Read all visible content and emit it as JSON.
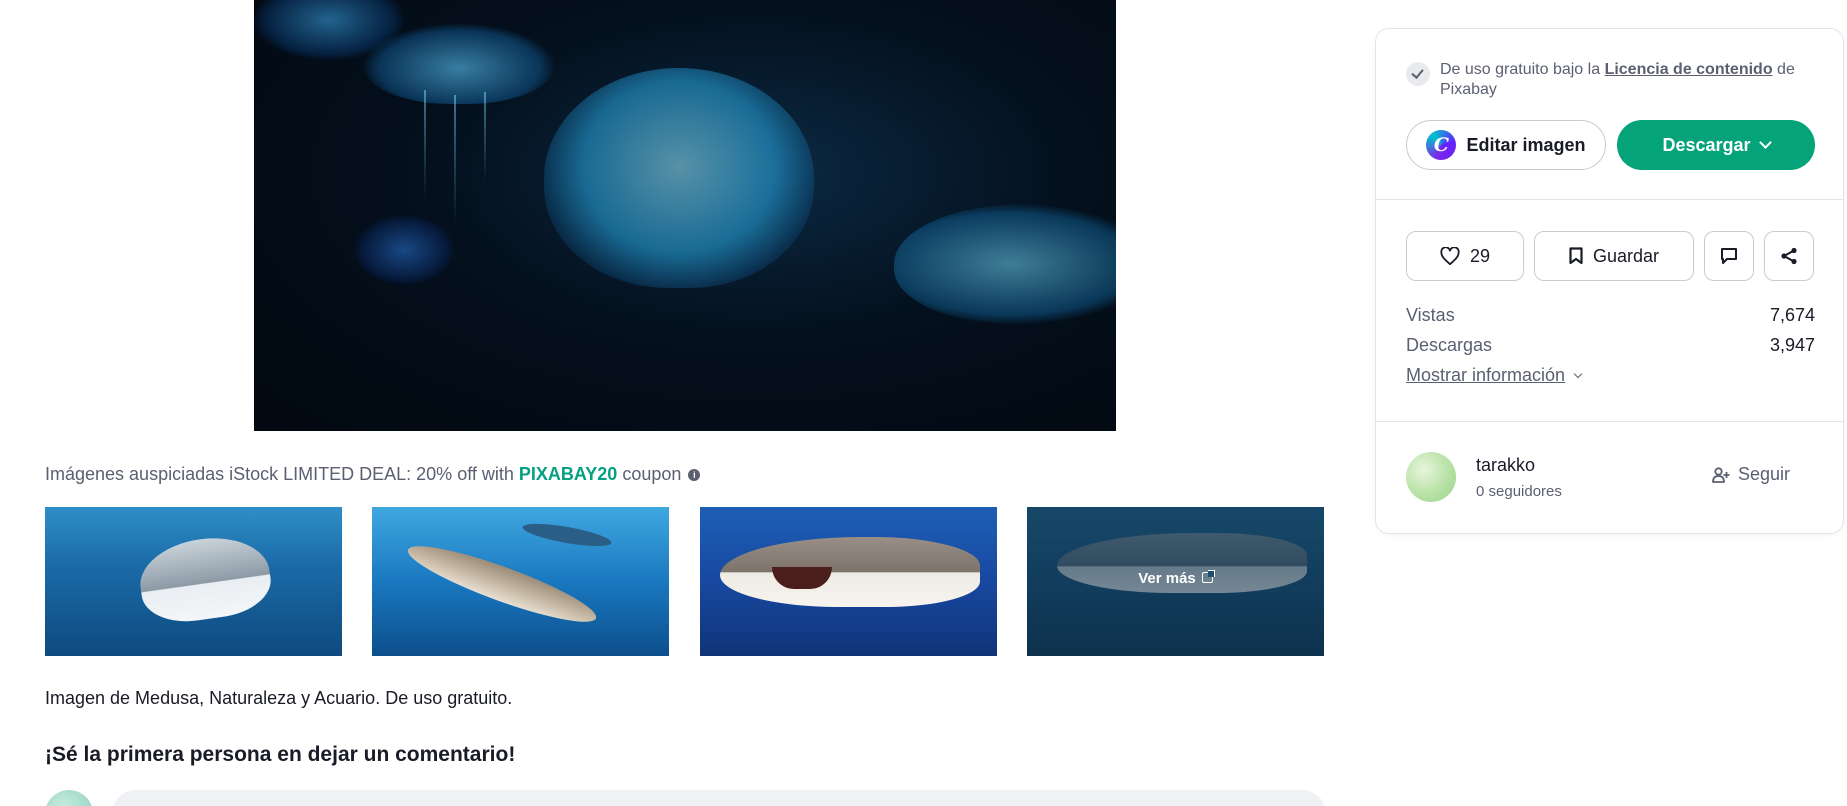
{
  "main_image": {
    "alt": "Medusa"
  },
  "sponsored": {
    "prefix": "Imágenes auspiciadas iStock LIMITED DEAL: 20% off with",
    "coupon": "PIXABAY20",
    "suffix": "coupon",
    "info_icon": "info-icon",
    "see_more": "Ver más",
    "coupon_color": "#05a081"
  },
  "description": "Imagen de Medusa, Naturaleza y Acuario. De uso gratuito.",
  "comments": {
    "title": "¡Sé la primera persona en dejar un comentario!"
  },
  "panel": {
    "license": {
      "prefix": "De uso gratuito bajo la",
      "link": "Licencia de contenido",
      "suffix": "de Pixabay"
    },
    "edit_label": "Editar imagen",
    "canva_letter": "C",
    "download_label": "Descargar",
    "download_color": "#04a37a",
    "likes": "29",
    "save_label": "Guardar",
    "stats": [
      {
        "label": "Vistas",
        "value": "7,674"
      },
      {
        "label": "Descargas",
        "value": "3,947"
      }
    ],
    "more_info": "Mostrar información",
    "author": {
      "name": "tarakko",
      "followers": "0 seguidores"
    },
    "follow_label": "Seguir"
  }
}
